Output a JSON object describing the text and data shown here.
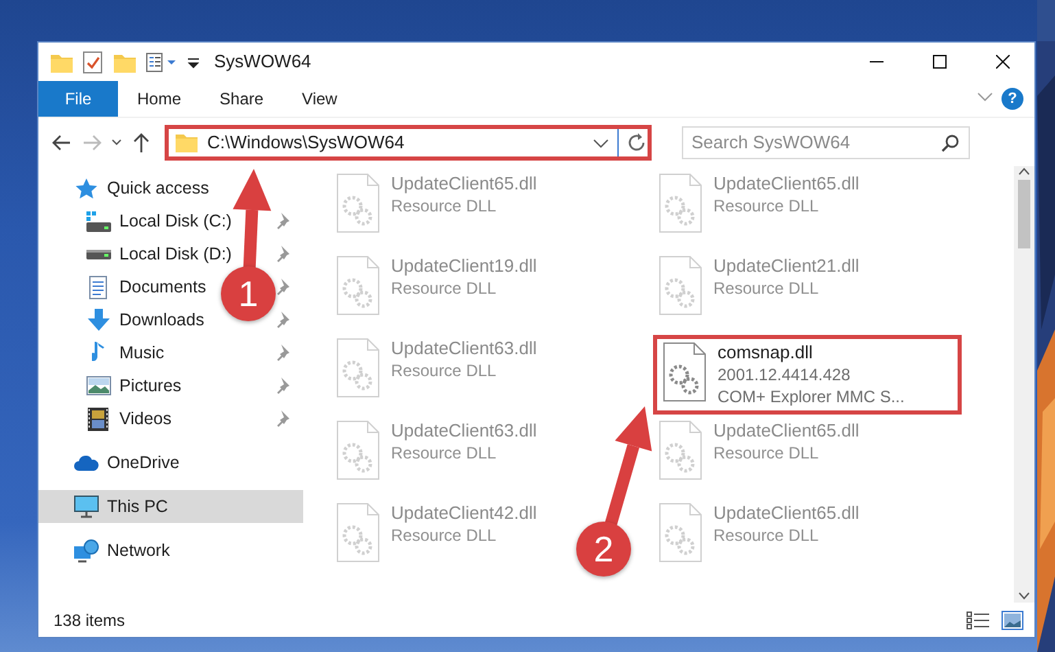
{
  "window": {
    "title": "SysWOW64"
  },
  "ribbon_tabs": [
    {
      "label": "File",
      "kind": "file",
      "selected": false
    },
    {
      "label": "Home",
      "kind": "tab",
      "selected": false
    },
    {
      "label": "Share",
      "kind": "tab",
      "selected": false
    },
    {
      "label": "View",
      "kind": "tab",
      "selected": false
    }
  ],
  "help_button": "?",
  "address": {
    "path": "C:\\Windows\\SysWOW64",
    "highlighted": true
  },
  "search": {
    "placeholder": "Search SysWOW64"
  },
  "navigation": [
    {
      "label": "Quick access",
      "kind": "star",
      "selected": false,
      "children": [
        {
          "label": "Local Disk (C:)",
          "kind": "disk-c",
          "pinned": true,
          "selected": false
        },
        {
          "label": "Local Disk (D:)",
          "kind": "disk",
          "pinned": true,
          "selected": false
        },
        {
          "label": "Documents",
          "kind": "documents",
          "pinned": true,
          "selected": false
        },
        {
          "label": "Downloads",
          "kind": "downloads",
          "pinned": true,
          "selected": false
        },
        {
          "label": "Music",
          "kind": "music",
          "pinned": true,
          "selected": false
        },
        {
          "label": "Pictures",
          "kind": "pictures",
          "pinned": true,
          "selected": false
        },
        {
          "label": "Videos",
          "kind": "videos",
          "pinned": true,
          "selected": false
        }
      ]
    },
    {
      "label": "OneDrive",
      "kind": "cloud",
      "selected": false
    },
    {
      "label": "This PC",
      "kind": "pc",
      "selected": true
    },
    {
      "label": "Network",
      "kind": "network",
      "selected": false
    }
  ],
  "files": [
    {
      "name": "UpdateClient65.dll",
      "details": [
        "Resource DLL"
      ],
      "dimmed": true,
      "highlighted": false
    },
    {
      "name": "UpdateClient65.dll",
      "details": [
        "Resource DLL"
      ],
      "dimmed": true,
      "highlighted": false
    },
    {
      "name": "UpdateClient19.dll",
      "details": [
        "Resource DLL"
      ],
      "dimmed": true,
      "highlighted": false
    },
    {
      "name": "UpdateClient21.dll",
      "details": [
        "Resource DLL"
      ],
      "dimmed": true,
      "highlighted": false
    },
    {
      "name": "UpdateClient63.dll",
      "details": [
        "Resource DLL"
      ],
      "dimmed": true,
      "highlighted": false
    },
    {
      "name": "comsnap.dll",
      "details": [
        "2001.12.4414.428",
        "COM+ Explorer MMC S..."
      ],
      "dimmed": false,
      "highlighted": true
    },
    {
      "name": "UpdateClient63.dll",
      "details": [
        "Resource DLL"
      ],
      "dimmed": true,
      "highlighted": false
    },
    {
      "name": "UpdateClient65.dll",
      "details": [
        "Resource DLL"
      ],
      "dimmed": true,
      "highlighted": false
    },
    {
      "name": "UpdateClient42.dll",
      "details": [
        "Resource DLL"
      ],
      "dimmed": true,
      "highlighted": false
    },
    {
      "name": "UpdateClient65.dll",
      "details": [
        "Resource DLL"
      ],
      "dimmed": true,
      "highlighted": false
    }
  ],
  "status_bar": {
    "item_count": "138 items"
  },
  "annotations": [
    {
      "number": "1"
    },
    {
      "number": "2"
    }
  ]
}
